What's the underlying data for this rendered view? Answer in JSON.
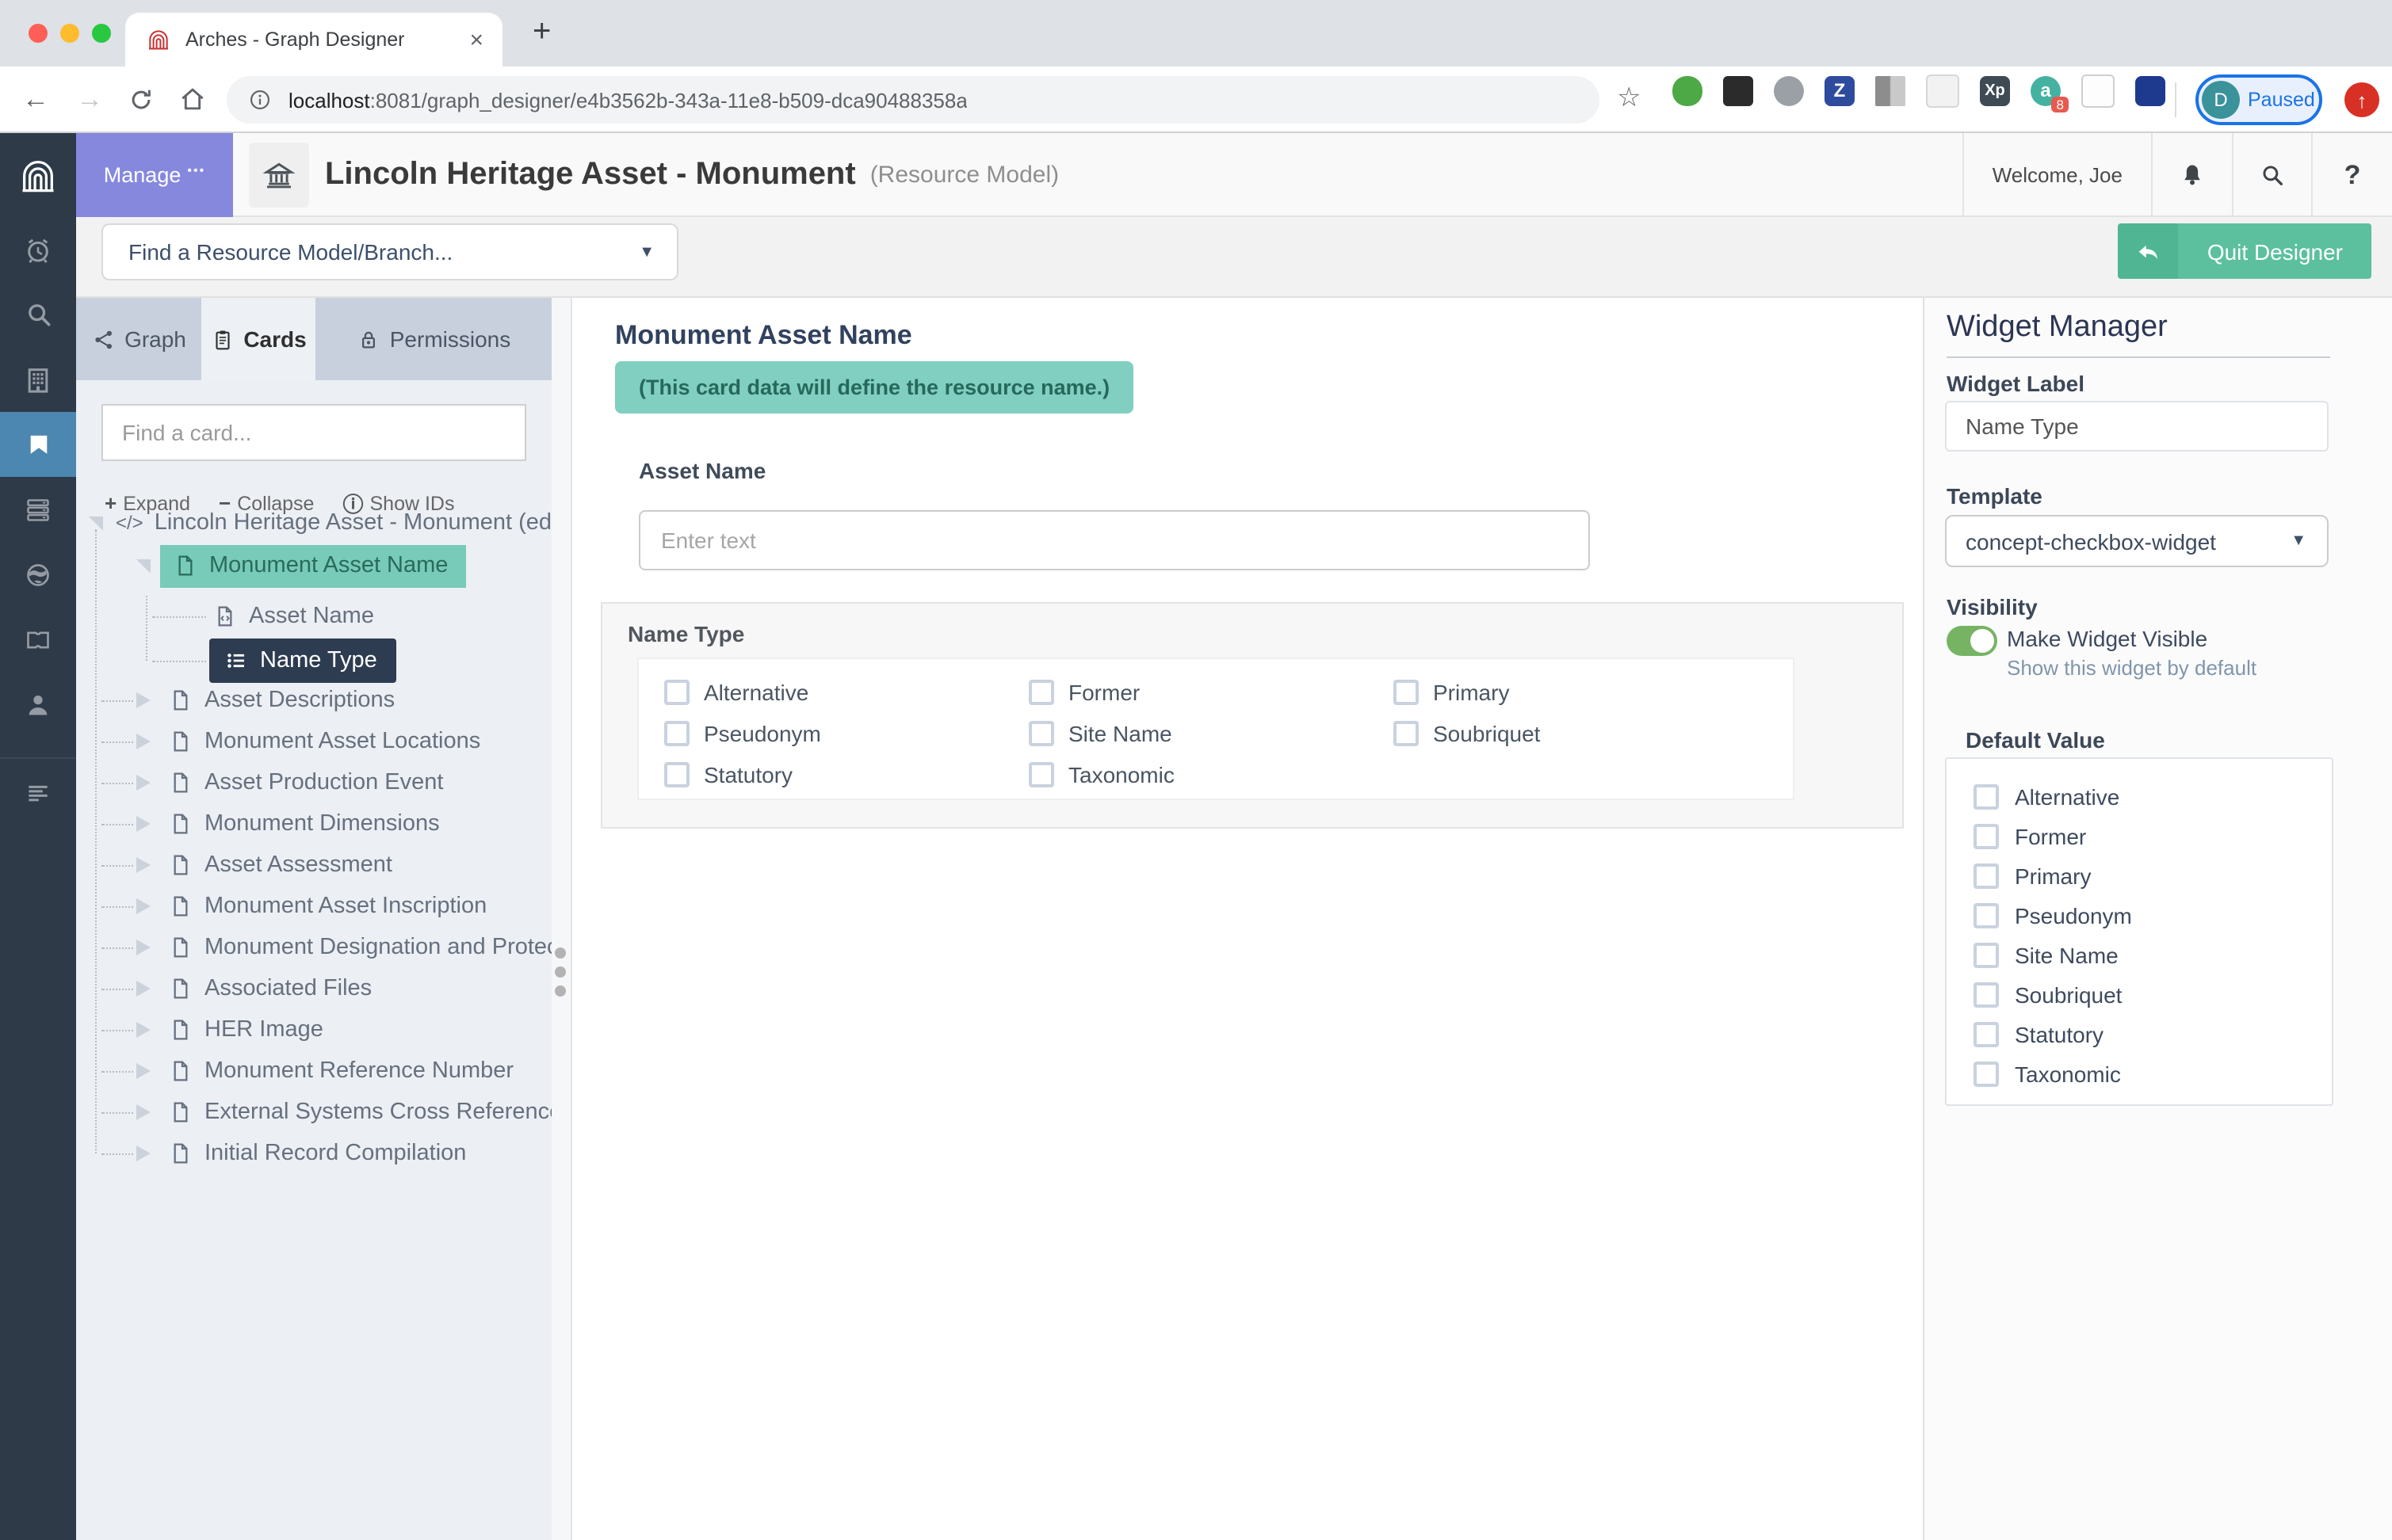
{
  "browser": {
    "tab_title": "Arches - Graph Designer",
    "url": {
      "host": "localhost",
      "rest": ":8081/graph_designer/e4b3562b-343a-11e8-b509-dca90488358a"
    },
    "profile": {
      "avatar_initial": "D",
      "status": "Paused"
    },
    "extensions": {
      "zotero_letter": "Z",
      "xp_letters": "Xp",
      "a_letter": "a",
      "a_badge": "8"
    }
  },
  "glyphs": {
    "back": "←",
    "forward": "→",
    "star": "☆",
    "close": "×",
    "new_tab": "+",
    "up": "↑",
    "caret_down": "▼",
    "plus": "+",
    "minus": "−",
    "info_circle": "ⓘ",
    "help": "?",
    "dots": "•••",
    "code": "</>"
  },
  "app_header": {
    "manage_label": "Manage",
    "title": "Lincoln Heritage Asset - Monument",
    "subtitle": "(Resource Model)",
    "welcome": "Welcome, Joe"
  },
  "toolbar": {
    "find_model_placeholder": "Find a Resource Model/Branch...",
    "quit_label": "Quit Designer"
  },
  "side_tabs": {
    "graph": "Graph",
    "cards": "Cards",
    "permissions": "Permissions"
  },
  "cards_panel": {
    "search_placeholder": "Find a card...",
    "expand": "Expand",
    "collapse": "Collapse",
    "show_ids": "Show IDs",
    "root_label": "Lincoln Heritage Asset - Monument (edit r",
    "selected_card": "Monument Asset Name",
    "widgets": [
      "Asset Name",
      "Name Type"
    ],
    "cards": [
      "Asset Descriptions",
      "Monument Asset Locations",
      "Asset Production Event",
      "Monument Dimensions",
      "Asset Assessment",
      "Monument Asset Inscription",
      "Monument Designation and Protectio",
      "Associated Files",
      "HER Image",
      "Monument Reference Number",
      "External Systems Cross Reference",
      "Initial Record Compilation"
    ]
  },
  "card_preview": {
    "title": "Monument Asset Name",
    "notice": "(This card data will define the resource name.)",
    "asset_name_label": "Asset Name",
    "asset_name_placeholder": "Enter text",
    "name_type_label": "Name Type",
    "options": [
      "Alternative",
      "Former",
      "Primary",
      "Pseudonym",
      "Site Name",
      "Soubriquet",
      "Statutory",
      "Taxonomic"
    ]
  },
  "widget_manager": {
    "title": "Widget Manager",
    "widget_label": "Widget Label",
    "widget_label_value": "Name Type",
    "template_label": "Template",
    "template_value": "concept-checkbox-widget",
    "visibility_label": "Visibility",
    "visible_label": "Make Widget Visible",
    "visible_hint": "Show this widget by default",
    "default_value_label": "Default Value",
    "options": [
      "Alternative",
      "Former",
      "Primary",
      "Pseudonym",
      "Site Name",
      "Soubriquet",
      "Statutory",
      "Taxonomic"
    ]
  },
  "colors": {
    "sidebar": "#2e3a47",
    "sidebar_active": "#4b87b0",
    "manage_purple": "#8688de",
    "teal_highlight": "#77cbb8",
    "selected_navy": "#2d3c50",
    "quit_green": "#5cc09f",
    "toggle_green": "#76b464",
    "chrome_blue": "#1a73e8",
    "update_red": "#d93025"
  }
}
